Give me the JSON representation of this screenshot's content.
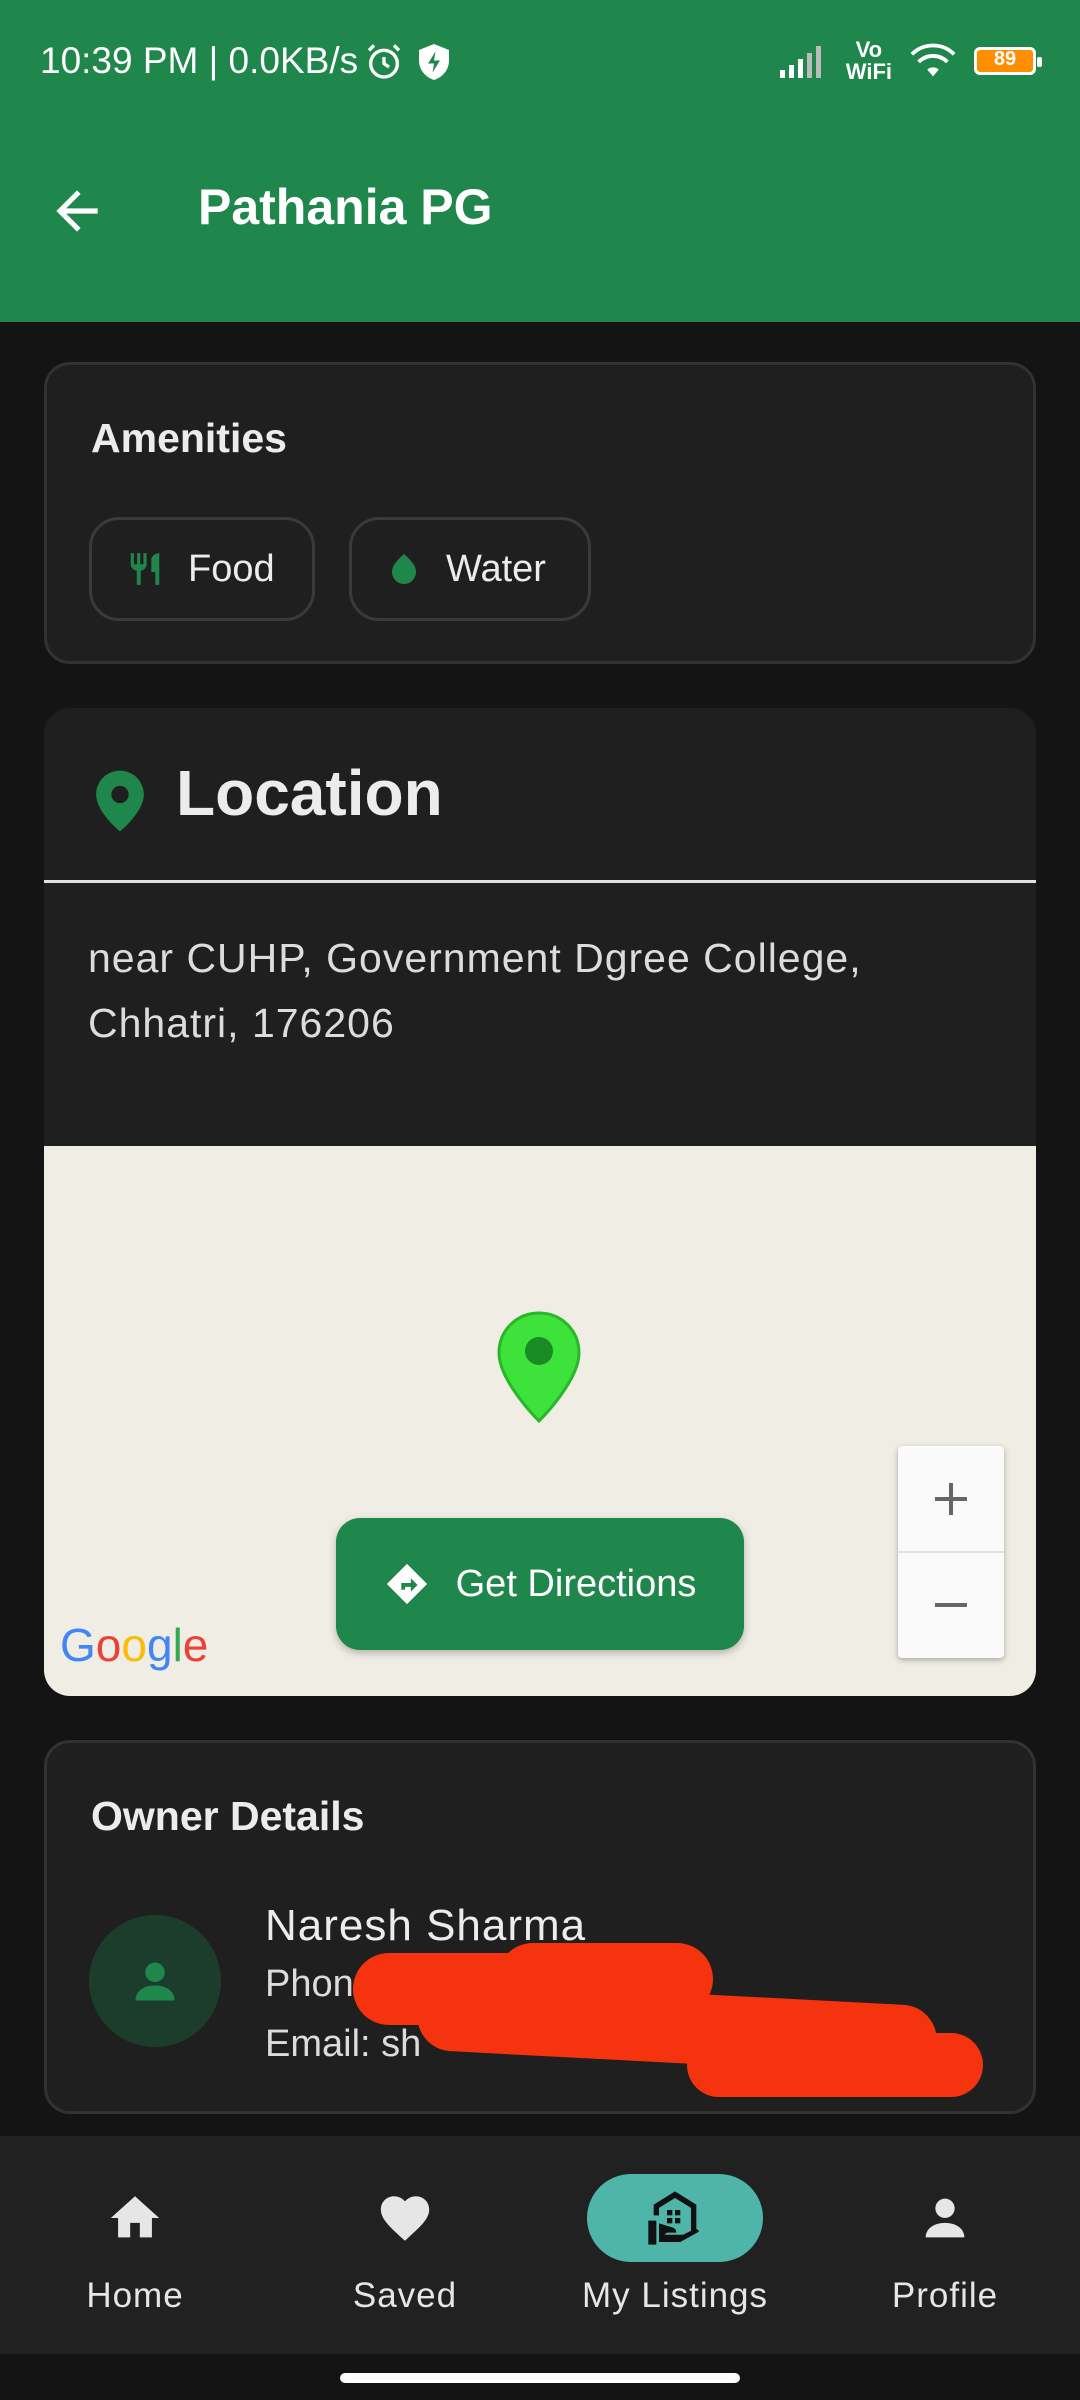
{
  "status_bar": {
    "time": "10:39 PM | 0.0KB/s",
    "network_label_top": "Vo",
    "network_label_bottom": "WiFi",
    "battery": "89"
  },
  "app_bar": {
    "title": "Pathania PG",
    "back_icon": "arrow-back-icon"
  },
  "amenities": {
    "title": "Amenities",
    "items": [
      {
        "label": "Food",
        "icon": "restaurant-icon"
      },
      {
        "label": "Water",
        "icon": "water-drop-icon"
      }
    ]
  },
  "location": {
    "title": "Location",
    "address": "near CUHP, Government Dgree College, Chhatri, 176206",
    "directions_label": "Get Directions",
    "map_attribution": "Google",
    "zoom_in": "+",
    "zoom_out": "−"
  },
  "owner": {
    "title": "Owner Details",
    "name": "Naresh Sharma",
    "phone_label": "Phon",
    "email_label": "Email: sh"
  },
  "bottom_nav": {
    "items": [
      {
        "label": "Home",
        "icon": "home-icon"
      },
      {
        "label": "Saved",
        "icon": "heart-icon"
      },
      {
        "label": "My Listings",
        "icon": "my-listings-icon",
        "selected": true
      },
      {
        "label": "Profile",
        "icon": "person-icon"
      }
    ]
  },
  "colors": {
    "primary": "#20874c",
    "background": "#141414",
    "card": "#1f1f1f",
    "nav_selected": "#4fb5a9",
    "pin": "#3de23a",
    "redaction": "#f5330f"
  }
}
